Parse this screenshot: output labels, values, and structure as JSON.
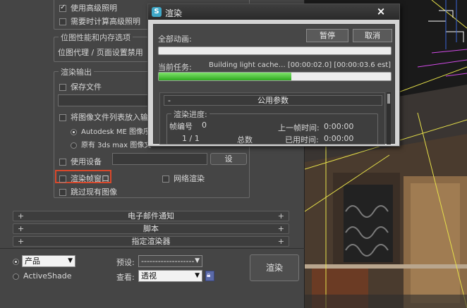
{
  "setup": {
    "use_advanced_lighting": "使用高级照明",
    "compute_advanced_lighting": "需要时计算高级照明",
    "bitmap_perf_group": "位图性能和内存选项",
    "bitmap_proxy_text": "位图代理 / 页面设置禁用",
    "render_output_group": "渲染输出",
    "save_file": "保存文件",
    "put_image_list": "将图像文件列表放入输",
    "autodesk_me": "Autodesk ME 图像序",
    "legacy_3dsmax": "原有 3ds max 图像文",
    "use_device": "使用设备",
    "device_btn": "设",
    "rendered_frame_window": "渲染帧窗口",
    "net_render": "网络渲染",
    "skip_existing": "跳过现有图像",
    "rollouts": [
      "电子邮件通知",
      "脚本",
      "指定渲染器"
    ],
    "mode_product": "产品",
    "mode_activeshade": "ActiveShade",
    "preset_label": "预设:",
    "preset_value": "-------------------",
    "view_label": "查看:",
    "view_value": "透视",
    "render_button": "渲染"
  },
  "dialog": {
    "title": "渲染",
    "close_glyph": "×",
    "all_anim_label": "全部动画:",
    "pause_button": "暂停",
    "cancel_button": "取消",
    "current_task_label": "当前任务:",
    "current_task_text": "Building light cache… [00:00:02.0] [00:00:03.6 est]",
    "current_progress": 0.57,
    "all_progress": 0.0,
    "common_params": "公用参数",
    "render_progress_group": "渲染进度:",
    "frame_number_label": "帧编号",
    "frame_number_value": "0",
    "frame_count": "1 / 1",
    "total_label": "总数",
    "last_frame_time_label": "上一帧时间:",
    "last_frame_time_value": "0:00:00",
    "elapsed_label": "已用时间:",
    "elapsed_value": "0:00:00"
  },
  "colors": {
    "progress_green": "#2ea81f",
    "highlight_red": "#d9482b",
    "scene_yellow": "#e6e04a",
    "scene_magenta": "#d24be8"
  }
}
